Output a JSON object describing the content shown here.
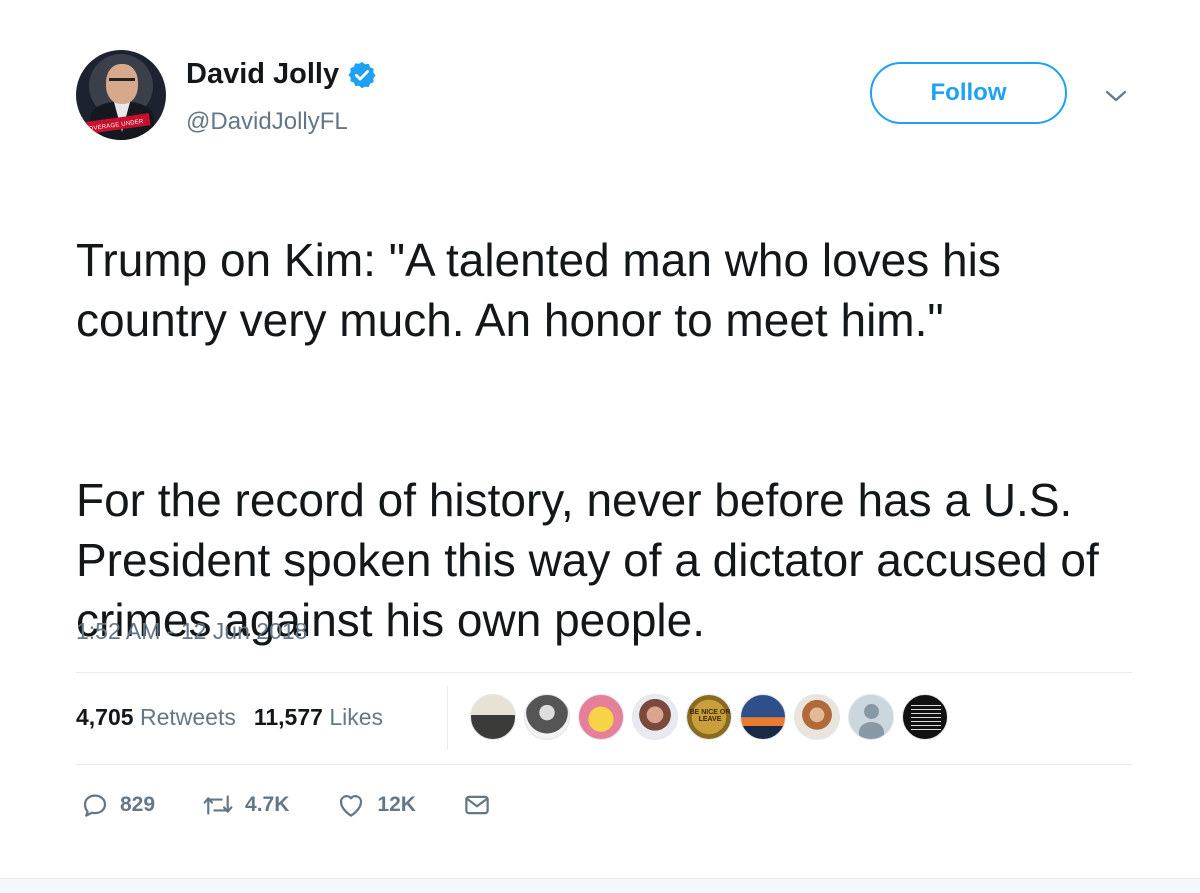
{
  "author": {
    "display_name": "David Jolly",
    "handle": "@DavidJollyFL",
    "avatar_banner_text": "COVERAGE UNDER"
  },
  "follow_button": {
    "label": "Follow"
  },
  "tweet": {
    "paragraphs": [
      "Trump on Kim: \"A talented man who loves his country very much. An honor to meet him.\"",
      "For the record of history, never before has a U.S. President spoken this way of a dictator accused of crimes against his own people."
    ],
    "timestamp": "1:52 AM - 12 Jun 2018"
  },
  "stats": {
    "retweets_count": "4,705",
    "retweets_label": "Retweets",
    "likes_count": "11,577",
    "likes_label": "Likes"
  },
  "liker_badge_text": "BE NICE OR LEAVE",
  "actions": {
    "reply_count": "829",
    "retweet_count": "4.7K",
    "like_count": "12K"
  },
  "colors": {
    "accent": "#1da1f2",
    "secondary_text": "#657786",
    "primary_text": "#14171a",
    "divider": "#e6ecf0"
  },
  "icons": [
    "verified-badge-icon",
    "chevron-down-icon",
    "reply-icon",
    "retweet-icon",
    "like-icon",
    "message-icon"
  ]
}
